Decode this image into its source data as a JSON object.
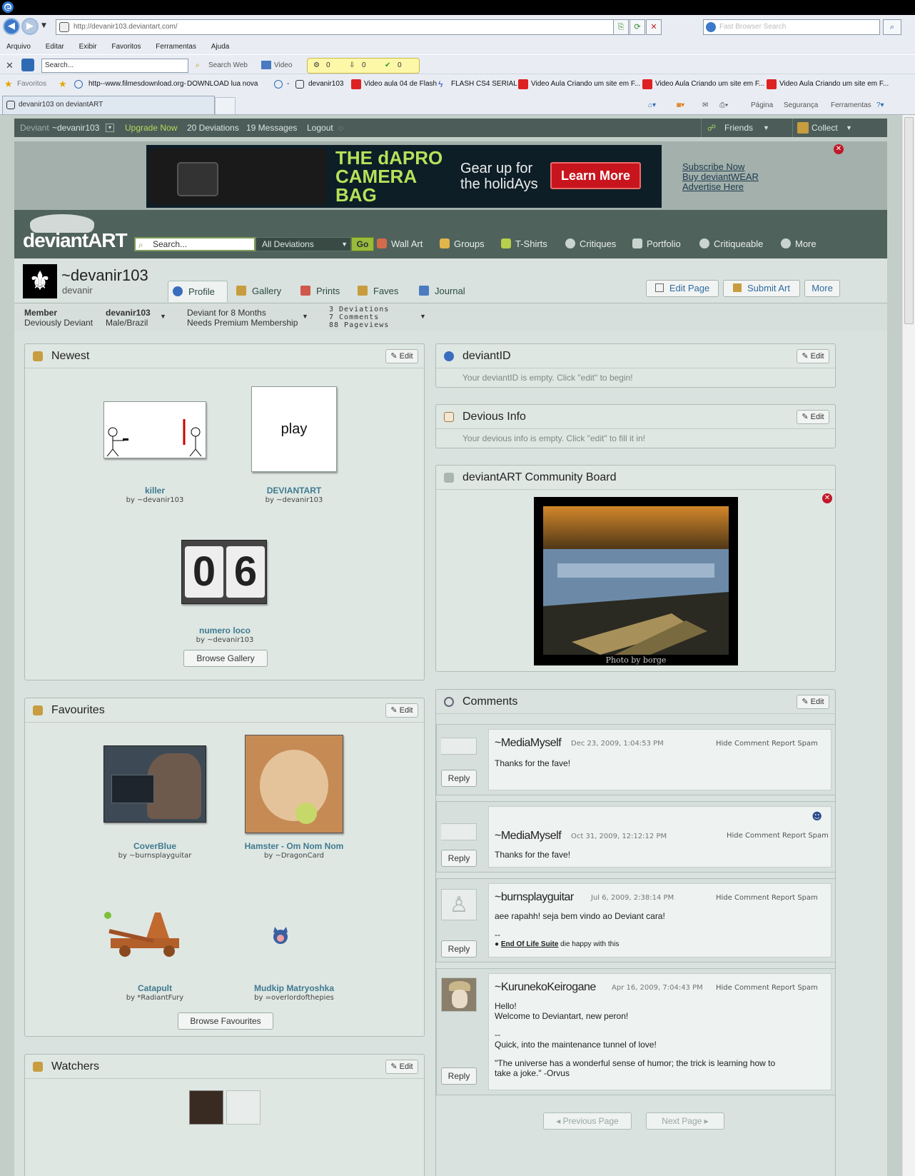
{
  "browser": {
    "url": "http://devanir103.deviantart.com/",
    "search_placeholder": "Fast Browser Search",
    "menu": [
      "Arquivo",
      "Editar",
      "Exibir",
      "Favoritos",
      "Ferramentas",
      "Ajuda"
    ],
    "toolbar": {
      "search_value": "Search...",
      "search_web": "Search Web",
      "video": "Video",
      "count1": "0",
      "count2": "0",
      "count3": "0"
    },
    "favorites_label": "Favoritos",
    "favorites": [
      "http--www.filmesdownload.org-",
      "DOWNLOAD lua nova",
      "-",
      "devanir103",
      "Video aula 04 de Flash",
      "FLASH CS4 SERIAL",
      "Video Aula Criando um site em F...",
      "Video Aula Criando um site em F...",
      "Video Aula Criando um site em F..."
    ],
    "tab_title": "devanir103 on deviantART",
    "commands": [
      "Página",
      "Segurança",
      "Ferramentas"
    ]
  },
  "da_bar": {
    "deviant_label": "Deviant",
    "user": "~devanir103",
    "upgrade": "Upgrade Now",
    "deviations": "20 Deviations",
    "messages": "19 Messages",
    "logout": "Logout",
    "friends": "Friends",
    "collect": "Collect"
  },
  "ad": {
    "headline1": "THE dAPRO",
    "headline2": "CAMERA",
    "headline3": "BAG",
    "tagline1": "Gear up for",
    "tagline2": "the holidAys",
    "cta": "Learn More",
    "links": [
      "Subscribe Now",
      "Buy deviantWEAR",
      "Advertise Here"
    ]
  },
  "header": {
    "logo": "deviantART",
    "search_placeholder": "Search...",
    "select": "All Deviations",
    "go": "Go",
    "nav": [
      "Wall Art",
      "Groups",
      "T-Shirts",
      "Critiques",
      "Portfolio",
      "Critiqueable",
      "More"
    ]
  },
  "profile": {
    "username": "~devanir103",
    "realname": "devanir",
    "tabs": [
      "Profile",
      "Gallery",
      "Prints",
      "Faves",
      "Journal"
    ],
    "buttons": [
      "Edit Page",
      "Submit Art",
      "More"
    ],
    "stats": {
      "member_label": "Member",
      "member_type": "Deviously Deviant",
      "handle": "devanir103",
      "demo": "Male/Brazil",
      "since": "Deviant for 8 Months",
      "membership": "Needs Premium Membership",
      "deviations": "3 Deviations",
      "comments": "7 Comments",
      "pageviews": "88 Pageviews"
    }
  },
  "newest": {
    "title": "Newest",
    "edit": "Edit",
    "items": [
      {
        "title": "killer",
        "by": "by ~devanir103"
      },
      {
        "title": "DEVIANTART",
        "by": "by ~devanir103",
        "thumb_text": "play"
      },
      {
        "title": "numero loco",
        "by": "by ~devanir103",
        "digits": [
          "0",
          "6"
        ]
      }
    ],
    "browse": "Browse Gallery"
  },
  "favourites": {
    "title": "Favourites",
    "edit": "Edit",
    "items": [
      {
        "title": "CoverBlue",
        "by": "by ~burnsplayguitar"
      },
      {
        "title": "Hamster - Om Nom Nom",
        "by": "by ~DragonCard"
      },
      {
        "title": "Catapult",
        "by": "by *RadiantFury"
      },
      {
        "title": "Mudkip Matryoshka",
        "by": "by =overlordofthepies"
      }
    ],
    "browse": "Browse Favourites"
  },
  "watchers": {
    "title": "Watchers",
    "edit": "Edit"
  },
  "deviantid": {
    "title": "deviantID",
    "edit": "Edit",
    "empty": "Your deviantID is empty. Click \"edit\" to begin!"
  },
  "devious_info": {
    "title": "Devious Info",
    "edit": "Edit",
    "empty": "Your devious info is empty. Click \"edit\" to fill it in!"
  },
  "community": {
    "title": "deviantART Community Board",
    "credit": "Photo by borge"
  },
  "comments": {
    "title": "Comments",
    "edit": "Edit",
    "hide": "Hide Comment",
    "spam": "Report Spam",
    "reply": "Reply",
    "list": [
      {
        "author": "~MediaMyself",
        "date": "Dec 23, 2009, 1:04:53 PM",
        "lines": [
          "Thanks for the fave!"
        ]
      },
      {
        "author": "~MediaMyself",
        "date": "Oct 31, 2009, 12:12:12 PM",
        "lines": [
          "Thanks for the fave!"
        ]
      },
      {
        "author": "~burnsplayguitar",
        "date": "Jul 6, 2009, 2:38:14 PM",
        "lines": [
          "aee rapahh! seja bem vindo ao Deviant cara!",
          "--"
        ],
        "sig_link": "End Of Life Suite",
        "sig_rest": "die happy with this"
      },
      {
        "author": "~KurunekoKeirogane",
        "date": "Apr 16, 2009, 7:04:43 PM",
        "lines": [
          "Hello!",
          "Welcome to Deviantart, new peron!",
          "",
          "--",
          "Quick, into the maintenance tunnel of love!",
          "",
          "\"The universe has a wonderful sense of humor; the trick is learning how to",
          "take a joke.\" -Orvus"
        ]
      }
    ],
    "prev": "Previous Page",
    "next": "Next Page"
  }
}
